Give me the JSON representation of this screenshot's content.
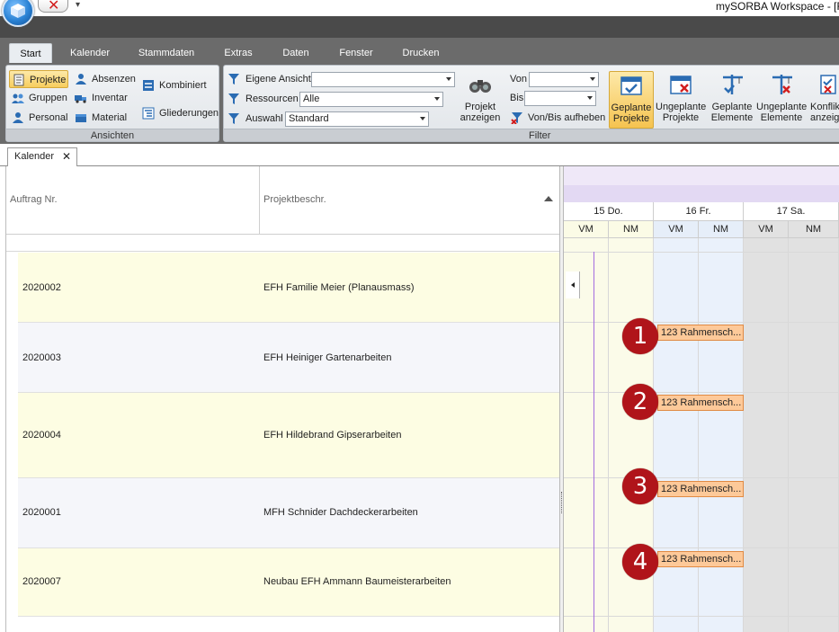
{
  "window": {
    "title": "mySORBA Workspace - [R",
    "quick_access_arrow": "▾"
  },
  "ribbon": {
    "tabs": [
      "Start",
      "Kalender",
      "Stammdaten",
      "Extras",
      "Daten",
      "Fenster",
      "Drucken"
    ],
    "active_tab": "Start",
    "groups": {
      "ansichten": {
        "label": "Ansichten",
        "items": {
          "projekte": "Projekte",
          "absenzen": "Absenzen",
          "kombiniert": "Kombiniert",
          "gruppen": "Gruppen",
          "inventar": "Inventar",
          "personal": "Personal",
          "material": "Material",
          "gliederungen": "Gliederungen"
        }
      },
      "filter": {
        "label": "Filter",
        "eigene_ansicht_label": "Eigene Ansicht",
        "eigene_ansicht_value": "",
        "ressourcen_label": "Ressourcen",
        "ressourcen_value": "Alle",
        "auswahl_label": "Auswahl",
        "auswahl_value": "Standard",
        "projekt_anzeigen_line1": "Projekt",
        "projekt_anzeigen_line2": "anzeigen",
        "von_label": "Von",
        "von_value": "",
        "bis_label": "Bis",
        "bis_value": "",
        "vonbis_aufheben": "Von/Bis aufheben",
        "geplante_projekte_line1": "Geplante",
        "geplante_projekte_line2": "Projekte",
        "ungeplante_projekte_line1": "Ungeplante",
        "ungeplante_projekte_line2": "Projekte",
        "geplante_elemente_line1": "Geplante",
        "geplante_elemente_line2": "Elemente",
        "ungeplante_elemente_line1": "Ungeplante",
        "ungeplante_elemente_line2": "Elemente",
        "konflikte_line1": "Konflik",
        "konflikte_line2": "anzeig"
      }
    }
  },
  "document_tab": {
    "label": "Kalender",
    "close": "✕"
  },
  "grid": {
    "columns": [
      "Auftrag Nr.",
      "Projektbeschr."
    ],
    "rows": [
      {
        "nr": "2020002",
        "beschr": "EFH Familie Meier (Planausmass)"
      },
      {
        "nr": "2020003",
        "beschr": "EFH Heiniger Gartenarbeiten"
      },
      {
        "nr": "2020004",
        "beschr": "EFH Hildebrand Gipserarbeiten"
      },
      {
        "nr": "2020001",
        "beschr": "MFH Schnider Dachdeckerarbeiten"
      },
      {
        "nr": "2020007",
        "beschr": "Neubau EFH Ammann Baumeisterarbeiten"
      }
    ]
  },
  "calendar": {
    "days": [
      "15 Do.",
      "16 Fr.",
      "17 Sa."
    ],
    "halves": [
      "VM",
      "NM",
      "VM",
      "NM",
      "VM",
      "NM"
    ],
    "events": [
      {
        "label": "123 Rahmensch...",
        "badge": "1"
      },
      {
        "label": "123 Rahmensch...",
        "badge": "2"
      },
      {
        "label": "123 Rahmensch...",
        "badge": "3"
      },
      {
        "label": "123 Rahmensch...",
        "badge": "4"
      }
    ]
  },
  "colors": {
    "row_highlight": "#fdfde3",
    "row_alt": "#f5f6fa",
    "event_fill": "#fdc999",
    "badge": "#b0141a",
    "today_line": "#a46ce0",
    "ribbon_selected": "#f7cd5e"
  }
}
